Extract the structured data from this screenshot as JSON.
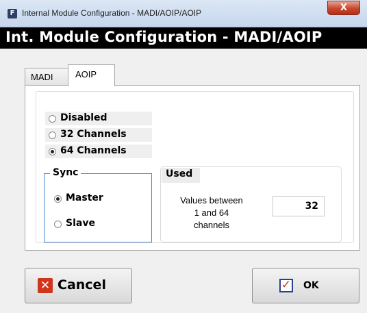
{
  "window": {
    "app_icon": "F",
    "title": "Internal Module Configuration - MADI/AOIP/AOIP",
    "close_glyph": "X"
  },
  "banner": {
    "title": "Int. Module Configuration - MADI/AOIP"
  },
  "tabs": [
    {
      "label": "MADI",
      "selected": false
    },
    {
      "label": "AOIP",
      "selected": true
    }
  ],
  "channels": {
    "options": [
      {
        "label": "Disabled",
        "selected": false
      },
      {
        "label": "32 Channels",
        "selected": false
      },
      {
        "label": "64 Channels",
        "selected": true
      }
    ]
  },
  "sync": {
    "legend": "Sync",
    "options": [
      {
        "label": "Master",
        "selected": true
      },
      {
        "label": "Slave",
        "selected": false
      }
    ]
  },
  "used": {
    "legend": "Used",
    "description": "Values between\n1 and 64\nchannels",
    "value": "32"
  },
  "buttons": {
    "cancel": {
      "label": "Cancel",
      "icon": "x-icon"
    },
    "ok": {
      "label": "OK",
      "icon": "checkbox-check-icon"
    }
  },
  "colors": {
    "banner_bg": "#000000",
    "sync_border": "#4a86c8",
    "cancel_icon": "#d0361e",
    "ok_check": "#d0361e",
    "ok_box": "#2c3e8f"
  }
}
